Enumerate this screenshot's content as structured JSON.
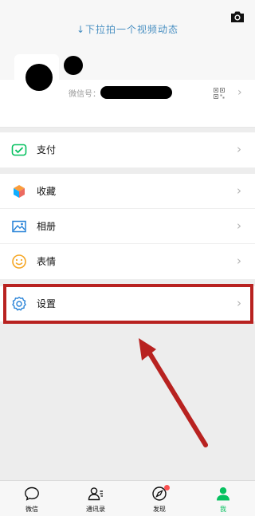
{
  "header": {
    "pull_hint": "↓下拉拍一个视频动态",
    "camera_icon": "camera-icon"
  },
  "profile": {
    "wechat_id_label": "微信号：",
    "qr_icon": "qr-code-icon"
  },
  "menu": {
    "pay": "支付",
    "favorites": "收藏",
    "album": "相册",
    "stickers": "表情",
    "settings": "设置"
  },
  "annotation": {
    "highlight_color": "#b82220"
  },
  "tabbar": {
    "chats": "微信",
    "contacts": "通讯录",
    "discover": "发现",
    "me": "我",
    "active_color": "#07c160",
    "badge_color": "#fa5151"
  }
}
